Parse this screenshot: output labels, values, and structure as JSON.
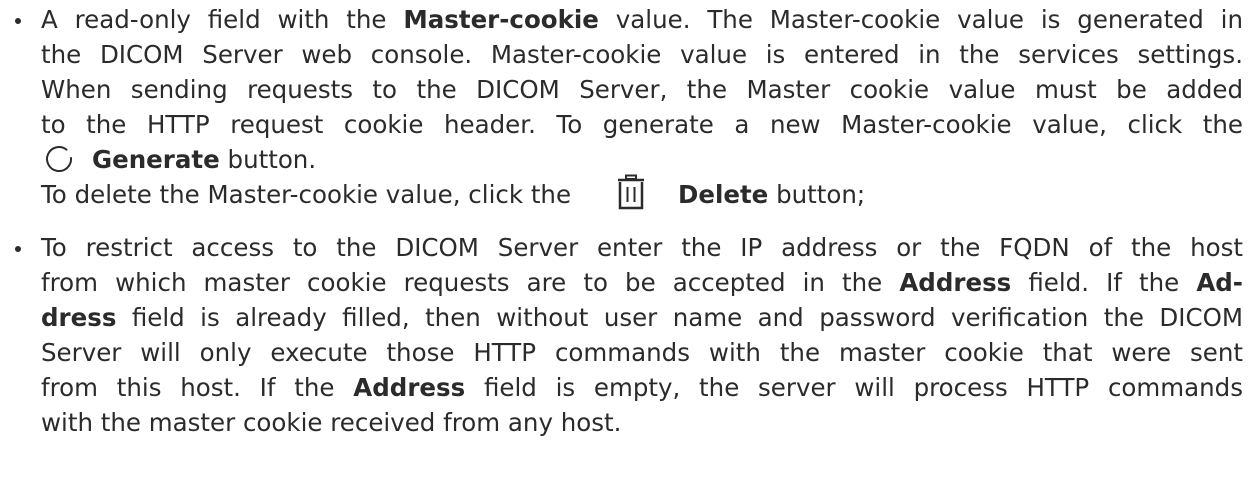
{
  "bullets": [
    {
      "lines": [
        {
          "segments": [
            {
              "text": "A read-only field with the ",
              "bold": false
            },
            {
              "text": "Master-cookie",
              "bold": true
            },
            {
              "text": " value.  The Master-cookie value is generated in",
              "bold": false
            }
          ]
        },
        {
          "segments": [
            {
              "text": "the DICOM Server web console.  Master-cookie value is entered in the services settings.",
              "bold": false
            }
          ]
        },
        {
          "segments": [
            {
              "text": "When sending requests to the DICOM Server, the Master cookie value must be added",
              "bold": false
            }
          ]
        },
        {
          "segments": [
            {
              "text": "to the HTTP request cookie header.  To generate a new Master-cookie value, click the",
              "bold": false
            }
          ]
        },
        {
          "segments": [
            {
              "text": "Generate",
              "bold": true
            },
            {
              "text": " button.",
              "bold": false
            }
          ]
        },
        {
          "segments": [
            {
              "text": "To delete the Master-cookie value, click the",
              "bold": false
            },
            {
              "text": "Delete",
              "bold": true
            },
            {
              "text": " button;",
              "bold": false
            }
          ]
        }
      ],
      "icons": {
        "generate": "refresh-icon",
        "delete": "trash-icon"
      }
    },
    {
      "lines": [
        {
          "segments": [
            {
              "text": "To restrict access to the DICOM Server enter the IP address or the FQDN of the host",
              "bold": false
            }
          ]
        },
        {
          "segments": [
            {
              "text": "from which master cookie requests are to be accepted in the ",
              "bold": false
            },
            {
              "text": "Address",
              "bold": true
            },
            {
              "text": " field.  If the ",
              "bold": false
            },
            {
              "text": "Ad-",
              "bold": true
            }
          ]
        },
        {
          "segments": [
            {
              "text": "dress",
              "bold": true
            },
            {
              "text": " field is already filled, then without user name and password verification the DICOM",
              "bold": false
            }
          ]
        },
        {
          "segments": [
            {
              "text": "Server will only execute those HTTP commands with the master cookie that were sent",
              "bold": false
            }
          ]
        },
        {
          "segments": [
            {
              "text": "from this host.  If the ",
              "bold": false
            },
            {
              "text": "Address",
              "bold": true
            },
            {
              "text": " field is empty, the server will process HTTP commands",
              "bold": false
            }
          ]
        },
        {
          "segments": [
            {
              "text": "with the master cookie received from any host.",
              "bold": false
            }
          ]
        }
      ]
    }
  ],
  "colors": {
    "text": "#2b2b2b",
    "icon": "#2b2b2b"
  }
}
